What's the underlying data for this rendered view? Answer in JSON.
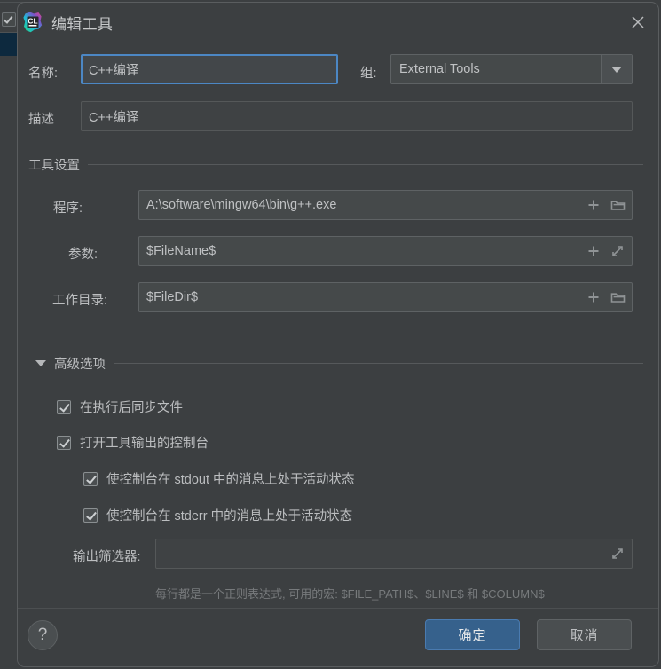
{
  "window": {
    "title": "编辑工具",
    "app_icon": "clion-icon",
    "close_icon": "close-icon"
  },
  "form": {
    "name_label": "名称:",
    "name_value": "C++编译",
    "group_label": "组:",
    "group_value": "External Tools",
    "group_dropdown_icon": "chevron-down-icon",
    "description_label": "描述",
    "description_value": "C++编译"
  },
  "tool_settings": {
    "section_title": "工具设置",
    "rows": [
      {
        "label": "程序:",
        "value": "A:\\software\\mingw64\\bin\\g++.exe",
        "icons": [
          "plus-icon",
          "folder-icon"
        ]
      },
      {
        "label": "参数:",
        "value": "$FileName$",
        "icons": [
          "plus-icon",
          "expand-icon"
        ]
      },
      {
        "label": "工作目录:",
        "value": "$FileDir$",
        "icons": [
          "plus-icon",
          "folder-icon"
        ]
      }
    ]
  },
  "advanced": {
    "section_title": "高级选项",
    "expanded": true,
    "expander_icon": "triangle-down-icon",
    "checkboxes": [
      {
        "label": "在执行后同步文件",
        "checked": true,
        "indent": 0
      },
      {
        "label": "打开工具输出的控制台",
        "checked": true,
        "indent": 0
      },
      {
        "label": "使控制台在 stdout 中的消息上处于活动状态",
        "checked": true,
        "indent": 1
      },
      {
        "label": "使控制台在 stderr 中的消息上处于活动状态",
        "checked": true,
        "indent": 1
      }
    ],
    "output_filter_label": "输出筛选器:",
    "output_filter_value": "",
    "output_filter_icon": "expand-icon",
    "output_filter_hint": "每行都是一个正则表达式, 可用的宏: $FILE_PATH$、$LINE$ 和 $COLUMN$"
  },
  "footer": {
    "help_label": "?",
    "help_icon": "question-mark-icon",
    "ok_label": "确定",
    "cancel_label": "取消"
  },
  "colors": {
    "dialog_bg": "#3c3f41",
    "field_bg": "#45494a",
    "focus_border": "#4c87c4",
    "primary_button_bg": "#36618c",
    "text": "#bcbec0",
    "hint_text": "#777a7c",
    "selected_row_bg": "#0d293e"
  }
}
